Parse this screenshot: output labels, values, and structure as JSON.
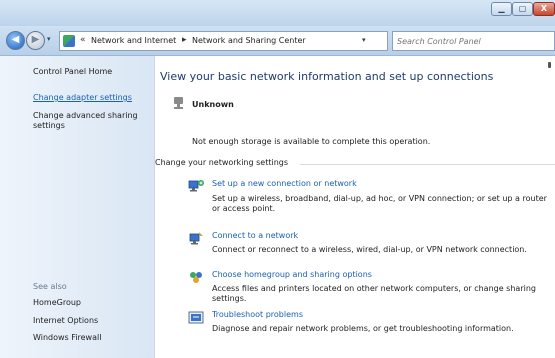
{
  "window": {
    "controls": {
      "minimize": "▁",
      "maximize": "▢",
      "close": "X"
    }
  },
  "navigation": {
    "back_icon": "back-arrow-icon",
    "forward_icon": "forward-arrow-icon",
    "history_dropdown": "▾",
    "breadcrumb_prefix": "«",
    "breadcrumbs": [
      "Network and Internet",
      "Network and Sharing Center"
    ],
    "breadcrumb_separator": "▸",
    "address_dropdown": "▾",
    "refresh_icon": "↻",
    "search_placeholder": "Search Control Panel"
  },
  "sidebar": {
    "home": "Control Panel Home",
    "items": [
      {
        "label": "Change adapter settings",
        "link": true
      },
      {
        "label": "Change advanced sharing settings",
        "link": false
      }
    ],
    "see_also_title": "See also",
    "see_also": [
      "HomeGroup",
      "Internet Options",
      "Windows Firewall"
    ]
  },
  "main": {
    "title": "View your basic network information and set up connections",
    "network_name": "Unknown",
    "error_message": "Not enough storage is available to complete this operation.",
    "section_title": "Change your networking settings",
    "tasks": [
      {
        "title": "Set up a new connection or network",
        "description": "Set up a wireless, broadband, dial-up, ad hoc, or VPN connection; or set up a router or access point.",
        "icon": "new-connection-icon"
      },
      {
        "title": "Connect to a network",
        "description": "Connect or reconnect to a wireless, wired, dial-up, or VPN network connection.",
        "icon": "connect-network-icon"
      },
      {
        "title": "Choose homegroup and sharing options",
        "description": "Access files and printers located on other network computers, or change sharing settings.",
        "icon": "homegroup-icon"
      },
      {
        "title": "Troubleshoot problems",
        "description": "Diagnose and repair network problems, or get troubleshooting information.",
        "icon": "troubleshoot-icon"
      }
    ]
  },
  "colors": {
    "link": "#1a5fb4",
    "title": "#1e3b6f",
    "sidebar_bg": "#e4edf7"
  }
}
